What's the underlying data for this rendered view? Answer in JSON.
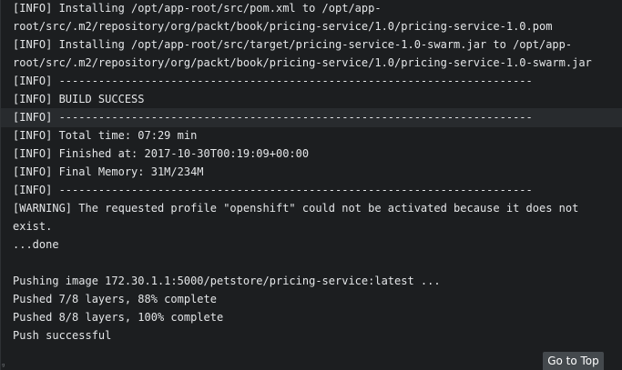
{
  "log": {
    "lines": [
      "[INFO] Installing /opt/app-root/src/pom.xml to /opt/app-",
      "root/src/.m2/repository/org/packt/book/pricing-service/1.0/pricing-service-1.0.pom",
      "[INFO] Installing /opt/app-root/src/target/pricing-service-1.0-swarm.jar to /opt/app-",
      "root/src/.m2/repository/org/packt/book/pricing-service/1.0/pricing-service-1.0-swarm.jar",
      "[INFO] ------------------------------------------------------------------------",
      "[INFO] BUILD SUCCESS",
      "[INFO] ------------------------------------------------------------------------",
      "[INFO] Total time: 07:29 min",
      "[INFO] Finished at: 2017-10-30T00:19:09+00:00",
      "[INFO] Final Memory: 31M/234M",
      "[INFO] ------------------------------------------------------------------------",
      "[WARNING] The requested profile \"openshift\" could not be activated because it does not",
      "exist.",
      "...done",
      "",
      "Pushing image 172.30.1.1:5000/petstore/pricing-service:latest ...",
      "Pushed 7/8 layers, 88% complete",
      "Pushed 8/8 layers, 100% complete",
      "Push successful"
    ]
  },
  "go_to_top": {
    "label": "Go to Top"
  },
  "corner": {
    "glyph": "ᵍ"
  }
}
